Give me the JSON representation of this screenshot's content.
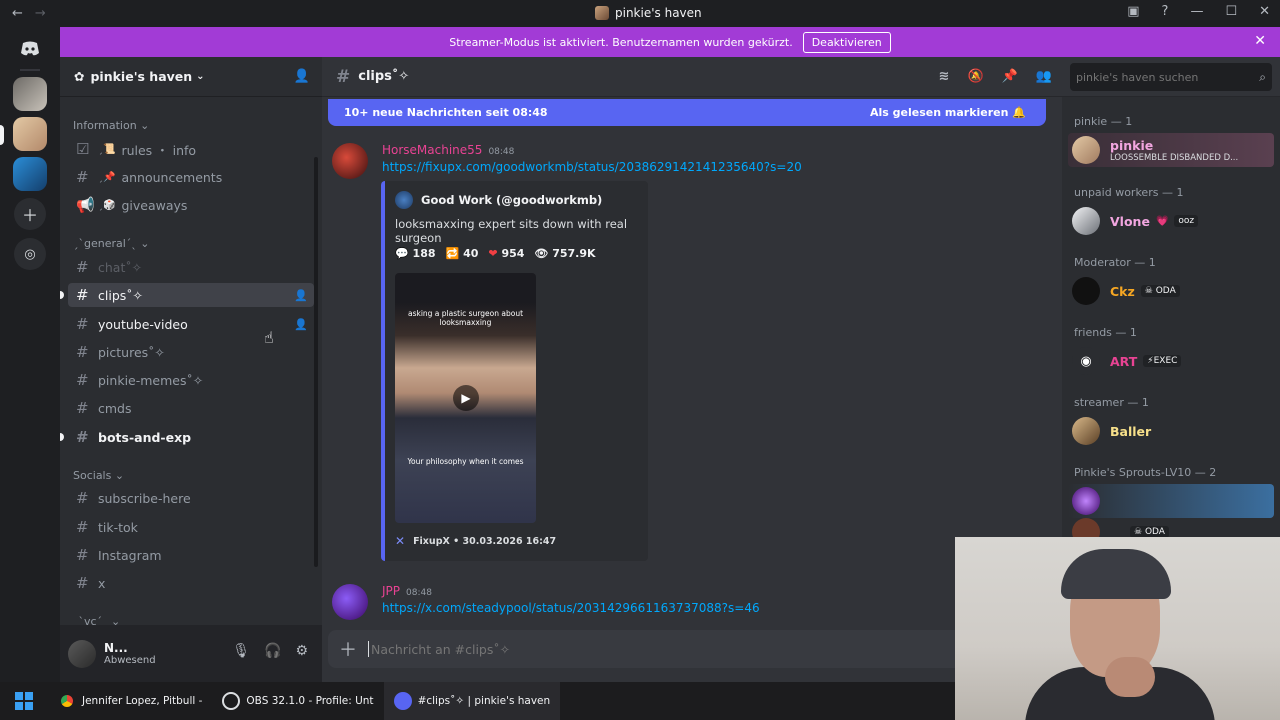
{
  "window": {
    "title": "pinkie's haven",
    "back_icon": "arrow-left-icon",
    "forward_icon": "arrow-right-icon"
  },
  "banner": {
    "text": "Streamer-Modus ist aktiviert. Benutzernamen wurden gekürzt.",
    "button": "Deaktivieren",
    "accent": "#a23bd6"
  },
  "guild": {
    "name": "pinkie's haven",
    "categories": {
      "information": "Information",
      "general": "ˏˋgeneralˊˎ",
      "socials": "Socials",
      "vc": "ˏˋvcˊˎ"
    },
    "channels": {
      "rules": "rules ・ info",
      "announcements": "announcements",
      "giveaways": "giveaways",
      "chat": "chat˚✧",
      "clips": "clips˚✧",
      "youtube": "youtube-video",
      "pictures": "pictures˚✧",
      "memes": "pinkie-memes˚✧",
      "cmds": "cmds",
      "bots": "bots-and-exp",
      "subscribe": "subscribe-here",
      "tiktok": "tik-tok",
      "instagram": "Instagram",
      "x": "x"
    }
  },
  "user": {
    "name": "N...",
    "status": "Abwesend"
  },
  "channel": {
    "name": "clips˚✧",
    "new_messages": "10+ neue Nachrichten seit 08:48",
    "mark_read": "Als gelesen markieren",
    "composer_placeholder": "Nachricht an #clips˚✧"
  },
  "messages": [
    {
      "author": "HorseMachine55",
      "time": "08:48",
      "link": "https://fixupx.com/goodworkmb/status/2038629142141235640?s=20",
      "embed": {
        "author": "Good Work (@goodworkmb)",
        "description": "looksmaxxing expert sits down with real surgeon",
        "stats": {
          "replies": "188",
          "retweets": "40",
          "likes": "954",
          "views": "757.9K"
        },
        "video_caption_top": "asking a plastic surgeon about looksmaxxing",
        "video_caption_bottom": "Your philosophy when it comes",
        "footer": "FixupX • 30.03.2026 16:47"
      }
    },
    {
      "author": "JPP",
      "time": "08:48",
      "link": "https://x.com/steadypool/status/2031429661163737088?s=46"
    }
  ],
  "search": {
    "placeholder": "pinkie's haven suchen"
  },
  "members": {
    "groups": [
      {
        "title": "pinkie — 1",
        "name": "pinkie",
        "sub": "LOOSSEMBLE DISBANDED D...",
        "color": "#f2a6e0"
      },
      {
        "title": "unpaid workers — 1",
        "name": "Vlone",
        "tag": "ooz",
        "color": "#f2a6e0"
      },
      {
        "title": "Moderator — 1",
        "name": "Ckz",
        "tag": "ODA",
        "color": "#f5a623"
      },
      {
        "title": "friends — 1",
        "name": "ART",
        "tag": "EXEC",
        "color": "#e84393"
      },
      {
        "title": "streamer — 1",
        "name": "Baller",
        "color": "#f7e08a"
      },
      {
        "title": "Pinkie's Sprouts-LV10 — 2",
        "tag": "ODA",
        "color": "#c084fc"
      }
    ]
  },
  "taskbar": {
    "chrome": "Jennifer Lopez, Pitbull -",
    "obs": "OBS 32.1.0 - Profile: Unt",
    "discord": "#clips˚✧ | pinkie's haven"
  }
}
